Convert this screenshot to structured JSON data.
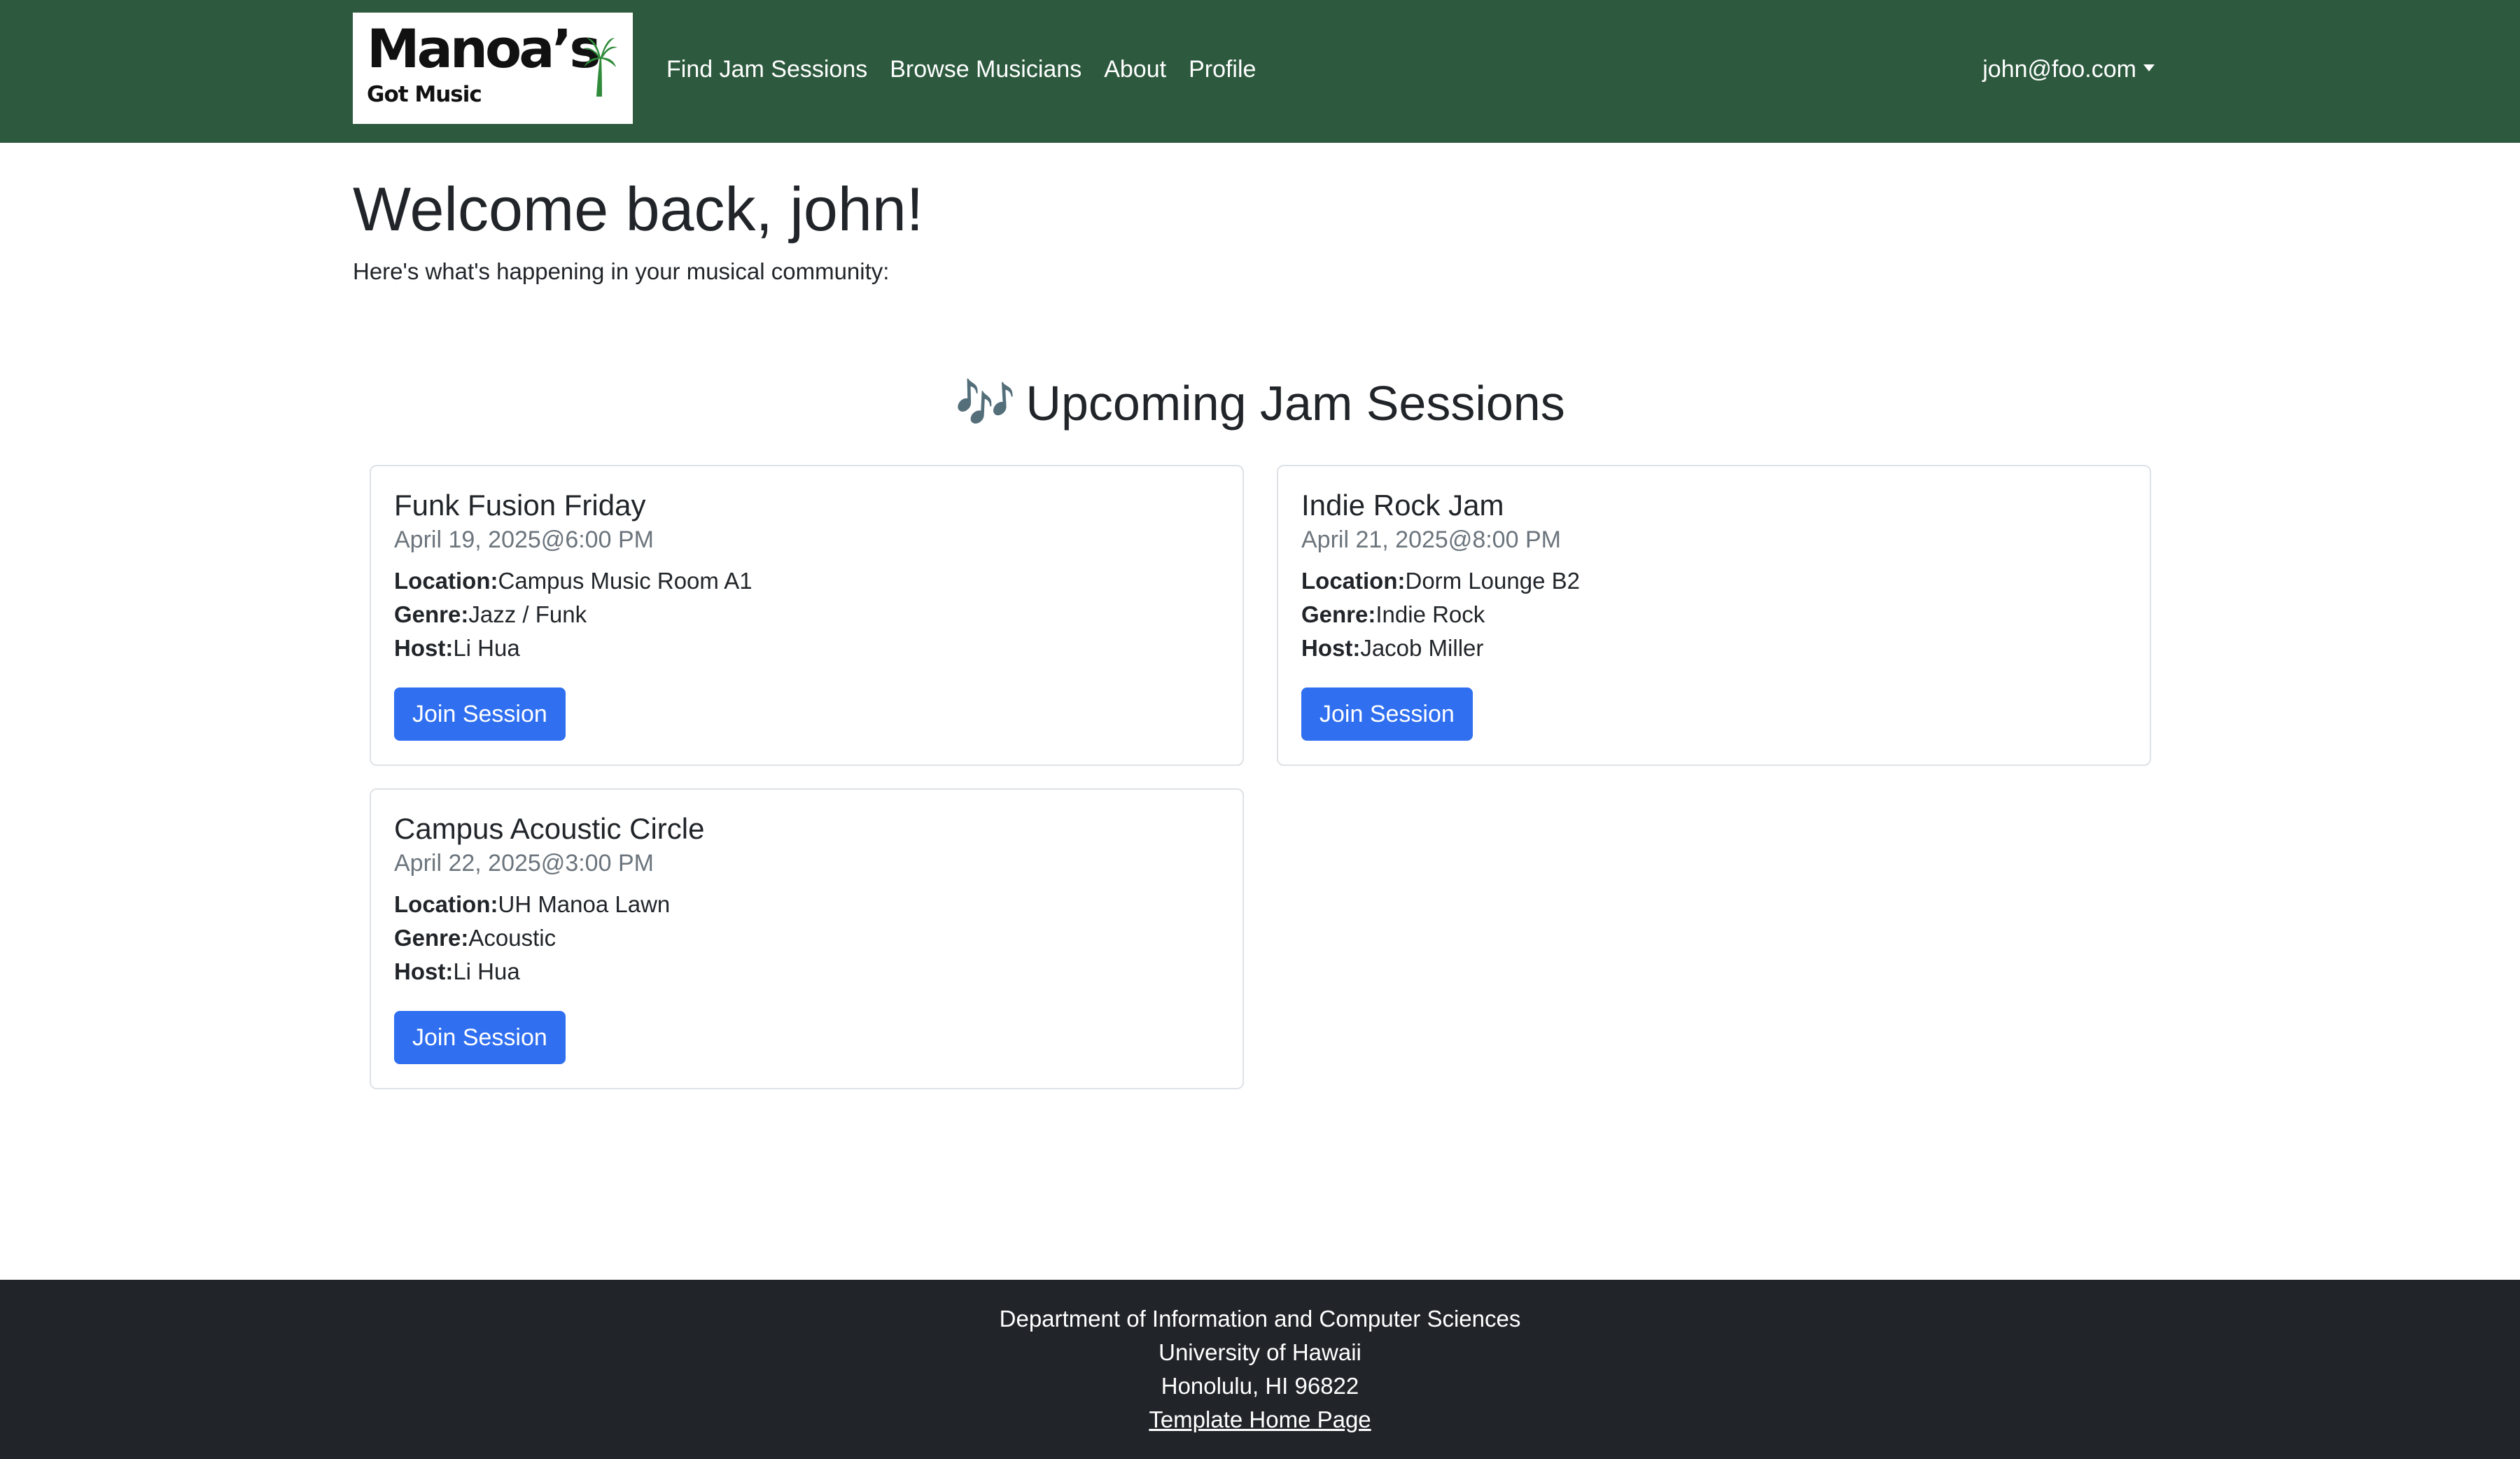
{
  "nav": {
    "brand_name": "Manoa’s",
    "brand_sub": "Got Music",
    "links": [
      "Find Jam Sessions",
      "Browse Musicians",
      "About",
      "Profile"
    ],
    "user_email": "john@foo.com"
  },
  "welcome": {
    "title": "Welcome back, john!",
    "subtitle": "Here's what's happening in your musical community:"
  },
  "sessions": {
    "heading": "Upcoming Jam Sessions",
    "heading_icon": "🎶",
    "location_label": "Location:",
    "genre_label": "Genre:",
    "host_label": "Host:",
    "button_label": "Join Session",
    "items": [
      {
        "title": "Funk Fusion Friday",
        "date": "April 19, 2025@6:00 PM",
        "location": "Campus Music Room A1",
        "genre": "Jazz / Funk",
        "host": "Li Hua"
      },
      {
        "title": "Indie Rock Jam",
        "date": "April 21, 2025@8:00 PM",
        "location": "Dorm Lounge B2",
        "genre": "Indie Rock",
        "host": "Jacob Miller"
      },
      {
        "title": "Campus Acoustic Circle",
        "date": "April 22, 2025@3:00 PM",
        "location": "UH Manoa Lawn",
        "genre": "Acoustic",
        "host": "Li Hua"
      }
    ]
  },
  "footer": {
    "line1": "Department of Information and Computer Sciences",
    "line2": "University of Hawaii",
    "line3": "Honolulu, HI 96822",
    "link": "Template Home Page"
  },
  "colors": {
    "navbar": "#2d5a3e",
    "button": "#2f6ff0",
    "footer": "#212529"
  }
}
